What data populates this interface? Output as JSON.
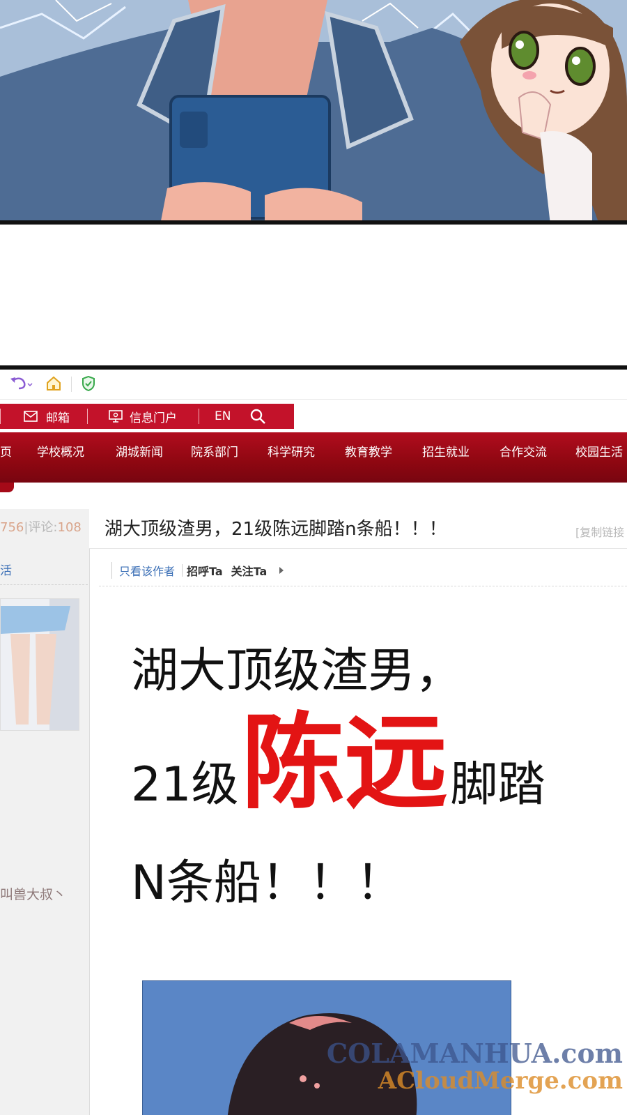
{
  "browser": {
    "toolbar_icons": [
      "undo-icon",
      "home-icon",
      "shield-icon"
    ]
  },
  "utility_bar": {
    "mail_label": "邮箱",
    "portal_label": "信息门户",
    "lang_label": "EN"
  },
  "nav": {
    "items": [
      "页",
      "学校概况",
      "湖城新闻",
      "院系部门",
      "科学研究",
      "教育教学",
      "招生就业",
      "合作交流",
      "校园生活"
    ]
  },
  "sidebar": {
    "stats_views_fragment": "756",
    "stats_comments_label": "评论:",
    "stats_comments_value": "108",
    "tag_fragment": "活",
    "username": "叫兽大叔丶"
  },
  "post": {
    "title": "湖大顶级渣男，21级陈远脚踏n条船！！！",
    "copy_link": "[复制链接",
    "author_actions": {
      "only_author": "只看该作者",
      "greet": "招呼Ta",
      "follow": "关注Ta"
    },
    "headline_line1": "湖大顶级渣男，",
    "headline_line2_prefix": "21级",
    "headline_line2_red": "陈远",
    "headline_line2_suffix": "脚踏",
    "headline_line3": "N条船！！！"
  },
  "watermark": {
    "line1": "COLAMANHUA.com",
    "line2": "ACloudMerge.com"
  },
  "colors": {
    "school_red": "#c3122a",
    "nav_dark_red": "#8e0711",
    "highlight_red": "#e31414",
    "link_blue": "#3b6fb6"
  }
}
